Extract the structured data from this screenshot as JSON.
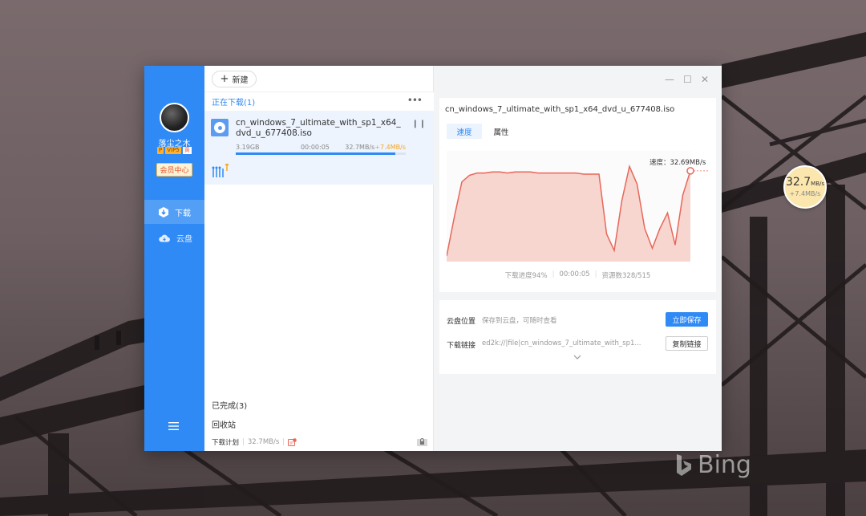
{
  "float_ball": {
    "speed_value": "32.7",
    "speed_unit": "MB/s",
    "boost": "+7.4MB/s"
  },
  "user": {
    "name": "落尘之木",
    "vip_badge": "P",
    "vip_label": "VIP5",
    "vip_extra": "黄",
    "member_center": "会员中心"
  },
  "nav": [
    {
      "label": "下载",
      "icon": "download-hex-icon"
    },
    {
      "label": "云盘",
      "icon": "cloud-icon"
    }
  ],
  "toolbar": {
    "new_label": "新建"
  },
  "list": {
    "downloading_header": "正在下载(1)",
    "task": {
      "name": "cn_windows_7_ultimate_with_sp1_x64_dvd_u_677408.iso",
      "size": "3.19GB",
      "time_left": "00:00:05",
      "speed": "32.7MB/s",
      "boost": "+7.4MB/s",
      "progress_percent": 94
    },
    "completed": "已完成(3)",
    "recycle": "回收站",
    "plan_label": "下载计划",
    "plan_speed": "32.7MB/s"
  },
  "detail": {
    "file_title": "cn_windows_7_ultimate_with_sp1_x64_dvd_u_677408.iso",
    "tab_speed": "速度",
    "tab_props": "属性",
    "speed_readout": "速度：32.69MB/s",
    "progress_text": "下载进度94%",
    "time_text": "00:00:05",
    "resources_text": "资源数328/515",
    "cloud_label": "云盘位置",
    "cloud_value": "保存到云盘，可随时查看",
    "save_button": "立即保存",
    "link_label": "下载链接",
    "link_value": "ed2k://|file|cn_windows_7_ultimate_with_sp1...",
    "copy_button": "复制链接"
  },
  "chart_data": {
    "type": "area",
    "title": "",
    "xlabel": "",
    "ylabel": "",
    "note": "download speed over time, shape only (no axis ticks shown)",
    "y": [
      0.05,
      0.4,
      0.72,
      0.78,
      0.8,
      0.8,
      0.81,
      0.81,
      0.8,
      0.81,
      0.81,
      0.81,
      0.8,
      0.8,
      0.8,
      0.8,
      0.8,
      0.8,
      0.79,
      0.79,
      0.79,
      0.25,
      0.1,
      0.55,
      0.86,
      0.7,
      0.3,
      0.12,
      0.3,
      0.44,
      0.15,
      0.6,
      0.82
    ]
  },
  "colors": {
    "accent": "#2f8af5",
    "chart_line": "#e8675a",
    "chart_fill": "#f6c9c1"
  },
  "watermark": "Bing"
}
